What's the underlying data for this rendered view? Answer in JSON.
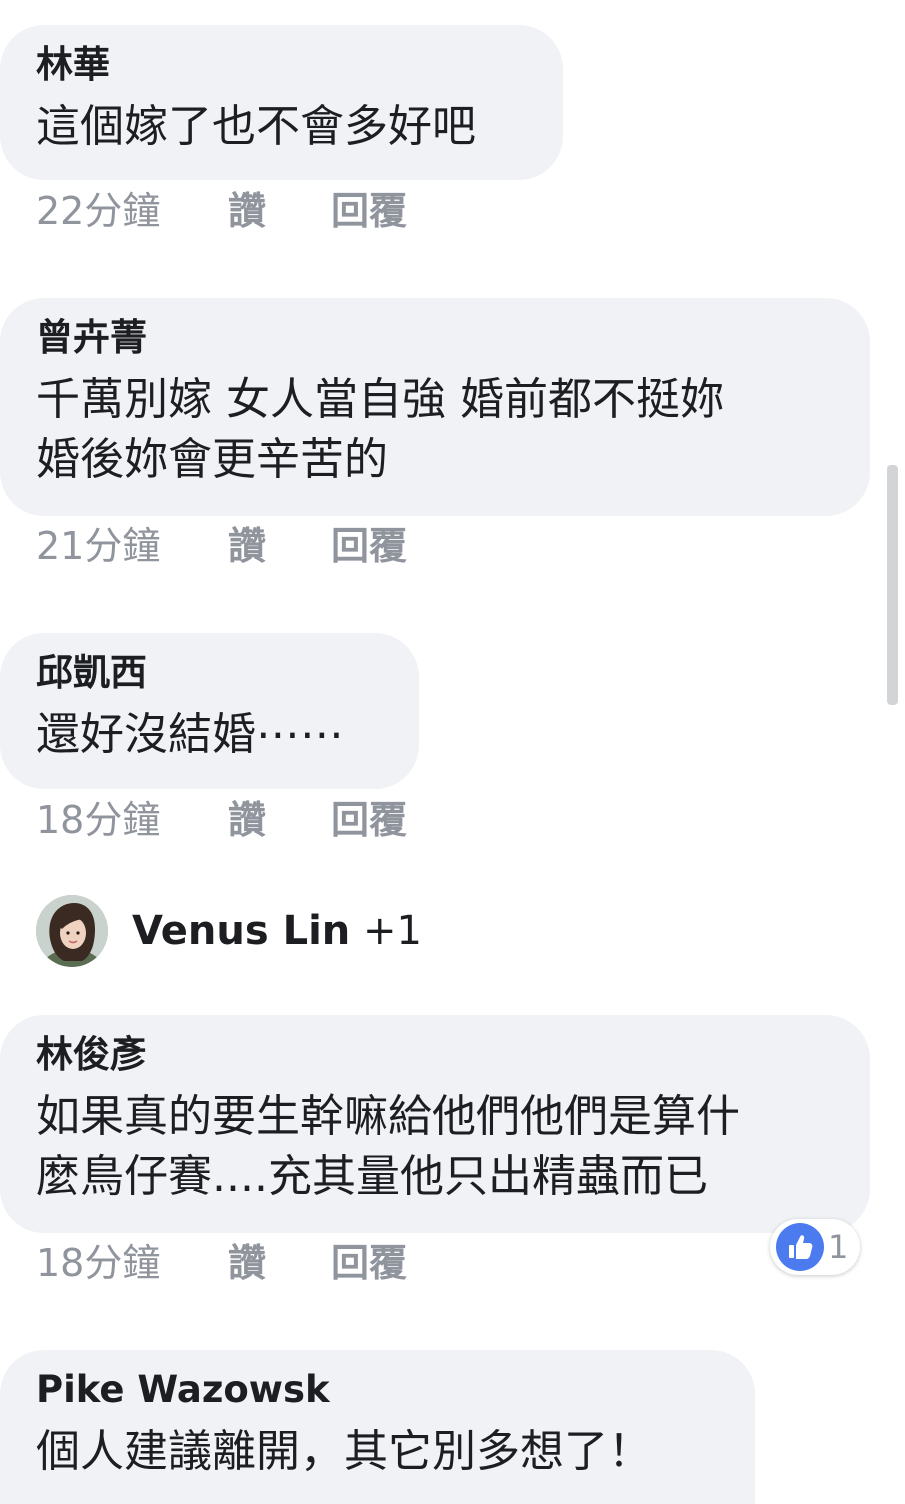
{
  "comments": [
    {
      "author": "林華",
      "lines": [
        "這個嫁了也不會多好吧"
      ],
      "time": "22分鐘",
      "like": "讚",
      "reply": "回覆"
    },
    {
      "author": "曾卉菁",
      "lines": [
        "千萬別嫁 女人當自強 婚前都不挺妳",
        "婚後妳會更辛苦的"
      ],
      "time": "21分鐘",
      "like": "讚",
      "reply": "回覆"
    },
    {
      "author": "邱凱西",
      "lines": [
        "還好沒結婚⋯⋯"
      ],
      "time": "18分鐘",
      "like": "讚",
      "reply": "回覆"
    },
    {
      "author": "林俊彥",
      "lines": [
        "如果真的要生幹嘛給他們他們是算什",
        "麼鳥仔賽....充其量他只出精蟲而已"
      ],
      "time": "18分鐘",
      "like": "讚",
      "reply": "回覆",
      "reaction_count": "1"
    },
    {
      "author": "Pike Wazowsk",
      "lines": [
        "個人建議離開，其它別多想了！"
      ]
    }
  ],
  "more_replies": {
    "name": "Venus Lin",
    "extra": "+1"
  },
  "icons": {
    "avatar": "user-avatar",
    "reaction": "thumbs-up-icon"
  },
  "colors": {
    "bubble": "#f0f2f5",
    "meta_text": "#90949c",
    "like_blue": "#4b7bef"
  }
}
